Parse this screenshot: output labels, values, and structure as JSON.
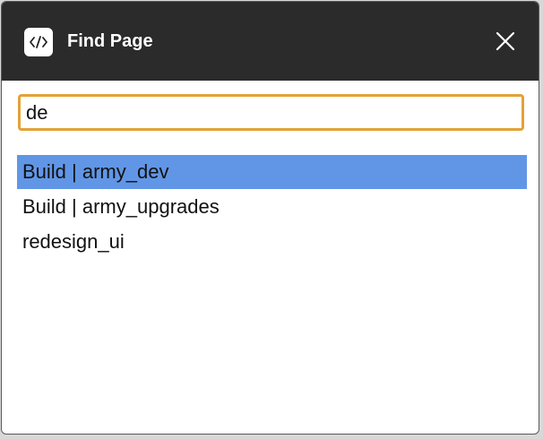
{
  "dialog": {
    "title": "Find Page",
    "icon": "code-brackets-icon",
    "close_icon": "close-icon"
  },
  "search": {
    "value": "de",
    "accent_color": "#e3a236"
  },
  "results": [
    {
      "label": "Build | army_dev",
      "selected": true
    },
    {
      "label": "Build | army_upgrades",
      "selected": false
    },
    {
      "label": "redesign_ui",
      "selected": false
    }
  ],
  "colors": {
    "titlebar": "#2b2b2b",
    "selection": "#6196e6"
  }
}
